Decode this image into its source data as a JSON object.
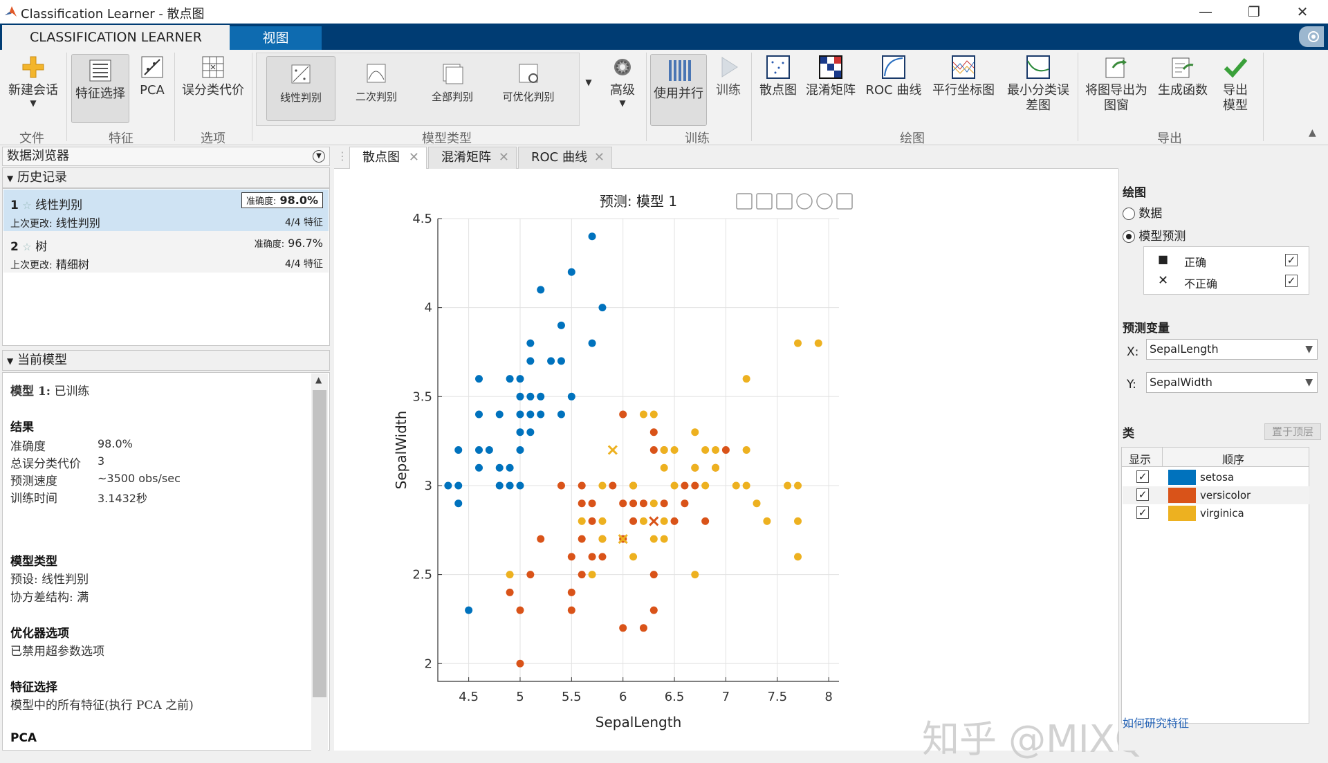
{
  "window": {
    "title": "Classification Learner - 散点图",
    "minimize": "—",
    "restore": "❐",
    "close": "✕"
  },
  "tabs": {
    "active": "CLASSIFICATION LEARNER",
    "view": "视图"
  },
  "ribbon": {
    "file": {
      "new_session": "新建会话",
      "group": "文件"
    },
    "feature": {
      "feature_selection": "特征选择",
      "pca": "PCA",
      "group": "特征"
    },
    "options": {
      "misclass_cost": "误分类代价",
      "group": "选项"
    },
    "model_type": {
      "items": [
        "线性判别",
        "二次判别",
        "全部判别",
        "可优化判别"
      ],
      "advanced": "高级",
      "group": "模型类型"
    },
    "train": {
      "parallel": "使用并行",
      "train": "训练",
      "group": "训练"
    },
    "plots": {
      "items": [
        "散点图",
        "混淆矩阵",
        "ROC 曲线",
        "平行坐标图",
        "最小分类误差图"
      ],
      "group": "绘图"
    },
    "export": {
      "export_plot": "将图导出为图窗",
      "gen_func": "生成函数",
      "export_model": "导出模型",
      "group": "导出"
    }
  },
  "data_browser": {
    "title": "数据浏览器",
    "history": {
      "title": "历史记录",
      "items": [
        {
          "num": "1",
          "name": "线性判别",
          "acc_label": "准确度:",
          "acc": "98.0%",
          "last_label": "上次更改:",
          "last": "线性判别",
          "features": "4/4 特征"
        },
        {
          "num": "2",
          "name": "树",
          "acc_label": "准确度:",
          "acc": "96.7%",
          "last_label": "上次更改:",
          "last": "精细树",
          "features": "4/4 特征"
        }
      ]
    },
    "current_model": {
      "title": "当前模型",
      "model_label": "模型 1:",
      "model_status": "已训练",
      "results": "结果",
      "rows": [
        [
          "准确度",
          "98.0%"
        ],
        [
          "总误分类代价",
          "3"
        ],
        [
          "预测速度",
          "~3500 obs/sec"
        ],
        [
          "训练时间",
          "3.1432秒"
        ]
      ],
      "model_type": "模型类型",
      "preset": "预设: 线性判别",
      "cov": "协方差结构: 满",
      "optimizer": "优化器选项",
      "optimizer_val": "已禁用超参数选项",
      "feat_sel": "特征选择",
      "feat_sel_val": "模型中的所有特征(执行 PCA 之前)",
      "pca": "PCA"
    }
  },
  "doc_tabs": [
    "散点图",
    "混淆矩阵",
    "ROC 曲线"
  ],
  "right_panel": {
    "plot": "绘图",
    "data": "数据",
    "model_pred": "模型预测",
    "correct": "正确",
    "incorrect": "不正确",
    "predictors": "预测变量",
    "x_label": "X:",
    "y_label": "Y:",
    "x_value": "SepalLength",
    "y_value": "SepalWidth",
    "classes": "类",
    "bring_front": "置于顶层",
    "col_show": "显示",
    "col_order": "顺序",
    "class_list": [
      {
        "name": "setosa",
        "color": "#0072bd"
      },
      {
        "name": "versicolor",
        "color": "#d95319"
      },
      {
        "name": "virginica",
        "color": "#edb120"
      }
    ],
    "help_link": "如何研究特征"
  },
  "watermark": "知乎 @MIXQ",
  "chart_data": {
    "type": "scatter",
    "title": "预测: 模型 1",
    "xlabel": "SepalLength",
    "ylabel": "SepalWidth",
    "xlim": [
      4.2,
      8.1
    ],
    "ylim": [
      1.9,
      4.5
    ],
    "xticks": [
      "4.5",
      "5",
      "5.5",
      "6",
      "6.5",
      "7",
      "7.5",
      "8"
    ],
    "yticks": [
      "2",
      "2.5",
      "3",
      "3.5",
      "4",
      "4.5"
    ],
    "grid": true,
    "colors": {
      "setosa": "#0072bd",
      "versicolor": "#d95319",
      "virginica": "#edb120"
    },
    "series": [
      {
        "name": "setosa",
        "points": [
          [
            5.7,
            4.4
          ],
          [
            5.5,
            4.2
          ],
          [
            5.2,
            4.1
          ],
          [
            5.8,
            4.0
          ],
          [
            5.4,
            3.9
          ],
          [
            5.7,
            3.8
          ],
          [
            5.1,
            3.8
          ],
          [
            5.1,
            3.7
          ],
          [
            5.3,
            3.7
          ],
          [
            5.4,
            3.7
          ],
          [
            4.6,
            3.6
          ],
          [
            4.9,
            3.6
          ],
          [
            5.0,
            3.6
          ],
          [
            5.0,
            3.5
          ],
          [
            5.1,
            3.5
          ],
          [
            5.2,
            3.5
          ],
          [
            5.5,
            3.5
          ],
          [
            4.6,
            3.4
          ],
          [
            4.8,
            3.4
          ],
          [
            5.0,
            3.4
          ],
          [
            5.1,
            3.4
          ],
          [
            5.2,
            3.4
          ],
          [
            5.4,
            3.4
          ],
          [
            5.0,
            3.3
          ],
          [
            5.1,
            3.3
          ],
          [
            4.4,
            3.2
          ],
          [
            4.6,
            3.2
          ],
          [
            4.7,
            3.2
          ],
          [
            5.0,
            3.2
          ],
          [
            4.6,
            3.1
          ],
          [
            4.8,
            3.1
          ],
          [
            4.9,
            3.1
          ],
          [
            4.3,
            3.0
          ],
          [
            4.4,
            3.0
          ],
          [
            4.8,
            3.0
          ],
          [
            4.9,
            3.0
          ],
          [
            5.0,
            3.0
          ],
          [
            4.4,
            2.9
          ],
          [
            4.5,
            2.3
          ]
        ]
      },
      {
        "name": "versicolor",
        "points": [
          [
            6.0,
            3.4
          ],
          [
            6.3,
            3.3
          ],
          [
            6.3,
            3.2
          ],
          [
            6.4,
            3.2
          ],
          [
            7.0,
            3.2
          ],
          [
            6.7,
            3.1
          ],
          [
            6.9,
            3.1
          ],
          [
            5.4,
            3.0
          ],
          [
            5.6,
            3.0
          ],
          [
            5.9,
            3.0
          ],
          [
            6.1,
            3.0
          ],
          [
            6.6,
            3.0
          ],
          [
            6.7,
            3.0
          ],
          [
            5.6,
            2.9
          ],
          [
            5.7,
            2.9
          ],
          [
            6.0,
            2.9
          ],
          [
            6.1,
            2.9
          ],
          [
            6.2,
            2.9
          ],
          [
            6.4,
            2.9
          ],
          [
            6.6,
            2.9
          ],
          [
            5.7,
            2.8
          ],
          [
            6.1,
            2.8
          ],
          [
            6.5,
            2.8
          ],
          [
            6.8,
            2.8
          ],
          [
            5.8,
            2.7
          ],
          [
            5.2,
            2.7
          ],
          [
            5.6,
            2.7
          ],
          [
            6.0,
            2.7
          ],
          [
            5.5,
            2.6
          ],
          [
            5.7,
            2.6
          ],
          [
            5.8,
            2.6
          ],
          [
            5.6,
            2.5
          ],
          [
            5.1,
            2.5
          ],
          [
            6.3,
            2.5
          ],
          [
            4.9,
            2.4
          ],
          [
            5.5,
            2.4
          ],
          [
            5.0,
            2.3
          ],
          [
            5.5,
            2.3
          ],
          [
            6.3,
            2.3
          ],
          [
            6.0,
            2.2
          ],
          [
            6.2,
            2.2
          ],
          [
            5.0,
            2.0
          ]
        ]
      },
      {
        "name": "virginica",
        "points": [
          [
            7.7,
            3.8
          ],
          [
            7.9,
            3.8
          ],
          [
            7.2,
            3.6
          ],
          [
            6.2,
            3.4
          ],
          [
            6.3,
            3.4
          ],
          [
            6.7,
            3.3
          ],
          [
            6.4,
            3.2
          ],
          [
            6.5,
            3.2
          ],
          [
            6.8,
            3.2
          ],
          [
            6.9,
            3.2
          ],
          [
            7.2,
            3.2
          ],
          [
            6.7,
            3.1
          ],
          [
            6.4,
            3.1
          ],
          [
            6.9,
            3.1
          ],
          [
            5.8,
            3.0
          ],
          [
            6.1,
            3.0
          ],
          [
            6.5,
            3.0
          ],
          [
            7.1,
            3.0
          ],
          [
            7.2,
            3.0
          ],
          [
            7.6,
            3.0
          ],
          [
            7.7,
            3.0
          ],
          [
            6.8,
            3.0
          ],
          [
            7.3,
            2.9
          ],
          [
            6.3,
            2.9
          ],
          [
            7.4,
            2.8
          ],
          [
            7.7,
            2.8
          ],
          [
            5.6,
            2.8
          ],
          [
            5.8,
            2.8
          ],
          [
            6.2,
            2.8
          ],
          [
            6.4,
            2.8
          ],
          [
            6.3,
            2.7
          ],
          [
            6.4,
            2.7
          ],
          [
            7.7,
            2.6
          ],
          [
            6.1,
            2.6
          ],
          [
            6.7,
            2.5
          ],
          [
            5.7,
            2.5
          ],
          [
            4.9,
            2.5
          ],
          [
            5.8,
            2.7
          ]
        ]
      }
    ],
    "incorrect": [
      {
        "x": 5.9,
        "y": 3.2,
        "class": "virginica"
      },
      {
        "x": 6.3,
        "y": 2.8,
        "class": "versicolor"
      },
      {
        "x": 6.0,
        "y": 2.7,
        "class": "virginica"
      }
    ]
  }
}
